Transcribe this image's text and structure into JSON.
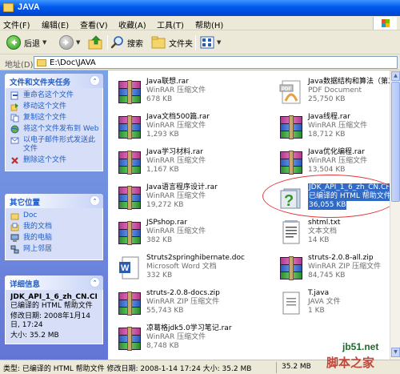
{
  "window": {
    "title": "JAVA"
  },
  "menu": {
    "items": [
      "文件(F)",
      "编辑(E)",
      "查看(V)",
      "收藏(A)",
      "工具(T)",
      "帮助(H)"
    ]
  },
  "toolbar": {
    "back_label": "后退",
    "search_label": "搜索",
    "folders_label": "文件夹"
  },
  "address": {
    "label": "地址(D)",
    "path": "E:\\Doc\\JAVA"
  },
  "sidebar": {
    "tasks": {
      "title": "文件和文件夹任务",
      "items": [
        "重命名这个文件",
        "移动这个文件",
        "复制这个文件",
        "将这个文件发布到 Web",
        "以电子邮件形式发送此文件",
        "删除这个文件"
      ]
    },
    "places": {
      "title": "其它位置",
      "items": [
        "Doc",
        "我的文档",
        "我的电脑",
        "网上邻居"
      ]
    },
    "details": {
      "title": "详细信息",
      "name": "JDK_API_1_6_zh_CN.CI",
      "type": "已编译的 HTML 帮助文件",
      "modified": "修改日期: 2008年1月14日, 17:24",
      "size": "大小: 35.2 MB"
    }
  },
  "files": [
    {
      "name": "Java联想.rar",
      "type": "WinRAR 压缩文件",
      "size": "678 KB",
      "icon": "rar-icon"
    },
    {
      "name": "Java数据结构和算法（第二",
      "type": "PDF Document",
      "size": "25,750 KB",
      "icon": "pdf-icon"
    },
    {
      "name": "Java文档500篇.rar",
      "type": "WinRAR 压缩文件",
      "size": "1,293 KB",
      "icon": "rar-icon"
    },
    {
      "name": "Java线程.rar",
      "type": "WinRAR 压缩文件",
      "size": "18,712 KB",
      "icon": "rar-icon"
    },
    {
      "name": "Java学习材料.rar",
      "type": "WinRAR 压缩文件",
      "size": "1,167 KB",
      "icon": "rar-icon"
    },
    {
      "name": "Java优化编程.rar",
      "type": "WinRAR 压缩文件",
      "size": "13,504 KB",
      "icon": "rar-icon"
    },
    {
      "name": "Java语言程序设计.rar",
      "type": "WinRAR 压缩文件",
      "size": "19,272 KB",
      "icon": "rar-icon"
    },
    {
      "name": "JDK_API_1_6_zh_CN.CHM",
      "type": "已编译的 HTML 帮助文件",
      "size": "36,055 KB",
      "icon": "chm-help-icon"
    },
    {
      "name": "JSPshop.rar",
      "type": "WinRAR 压缩文件",
      "size": "382 KB",
      "icon": "rar-icon"
    },
    {
      "name": "shtml.txt",
      "type": "文本文档",
      "size": "14 KB",
      "icon": "text-file-icon"
    },
    {
      "name": "Struts2springhibernate.doc",
      "type": "Microsoft Word 文档",
      "size": "332 KB",
      "icon": "word-doc-icon"
    },
    {
      "name": "struts-2.0.8-all.zip",
      "type": "WinRAR ZIP 压缩文件",
      "size": "84,745 KB",
      "icon": "zip-icon"
    },
    {
      "name": "struts-2.0.8-docs.zip",
      "type": "WinRAR ZIP 压缩文件",
      "size": "55,743 KB",
      "icon": "zip-icon"
    },
    {
      "name": "T.java",
      "type": "JAVA 文件",
      "size": "1 KB",
      "icon": "java-file-icon"
    },
    {
      "name": "凉葛格jdk5.0学习笔记.rar",
      "type": "WinRAR 压缩文件",
      "size": "8,748 KB",
      "icon": "rar-icon"
    }
  ],
  "status": {
    "type_text": "类型: 已编译的 HTML 帮助文件 修改日期: 2008-1-14 17:24 大小: 35.2 MB",
    "size_text": "35.2 MB"
  },
  "watermark": {
    "line1": "jb51.net",
    "line2": "脚本之家"
  },
  "colors": {
    "titlebar": "#0058ee",
    "selection": "#316ac5",
    "sidebar": "#6375d6",
    "highlight_ellipse": "#e03a3a"
  }
}
